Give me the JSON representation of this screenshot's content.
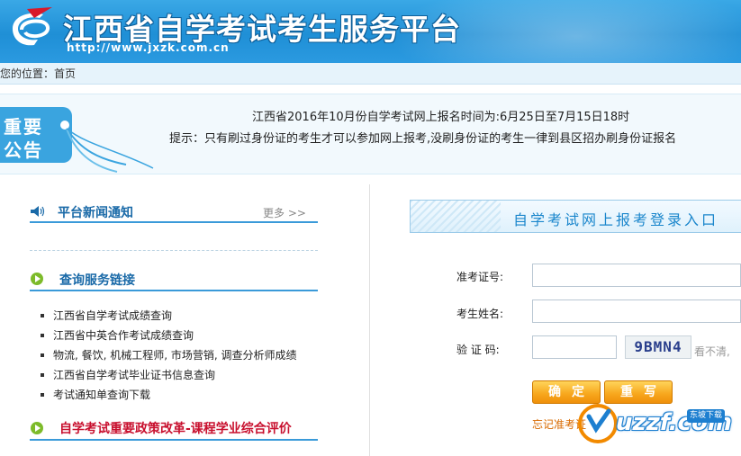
{
  "header": {
    "title": "江西省自学考试考生服务平台",
    "url": "http://www.jxzk.com.cn"
  },
  "breadcrumb": {
    "prefix": "您的位置：",
    "current": "首页"
  },
  "notice": {
    "badge_line1": "重要",
    "badge_line2": "公告",
    "line1": "江西省2016年10月份自学考试网上报名时间为:6月25日至7月15日18时",
    "line2": "提示：只有刷过身份证的考生才可以参加网上报考,没刷身份证的考生一律到县区招办刷身份证报名"
  },
  "news": {
    "title": "平台新闻通知",
    "more": "更多 >>"
  },
  "links": {
    "title": "查询服务链接",
    "items": [
      "江西省自学考试成绩查询",
      "江西省中英合作考试成绩查询",
      "物流, 餐饮, 机械工程师, 市场营销, 调查分析师成绩",
      "江西省自学考试毕业证书信息查询",
      "考试通知单查询下载"
    ]
  },
  "policy": {
    "title": "自学考试重要政策改革-课程学业综合评价"
  },
  "login": {
    "title": "自学考试网上报考登录入口",
    "exam_no_label": "准考证号:",
    "name_label": "考生姓名:",
    "captcha_label": "验 证 码:",
    "captcha_code": "9BMN4",
    "captcha_hint": "看不清,",
    "confirm_button": "确定",
    "reset_button": "重写",
    "forgot": "忘记准考证"
  },
  "watermark": {
    "text": "uzzf.com",
    "tag": "东坡下载"
  },
  "colors": {
    "header_blue": "#1f8fd6",
    "section_blue": "#1a6aa8",
    "policy_red": "#c8102e",
    "button_orange": "#f7a61c"
  }
}
